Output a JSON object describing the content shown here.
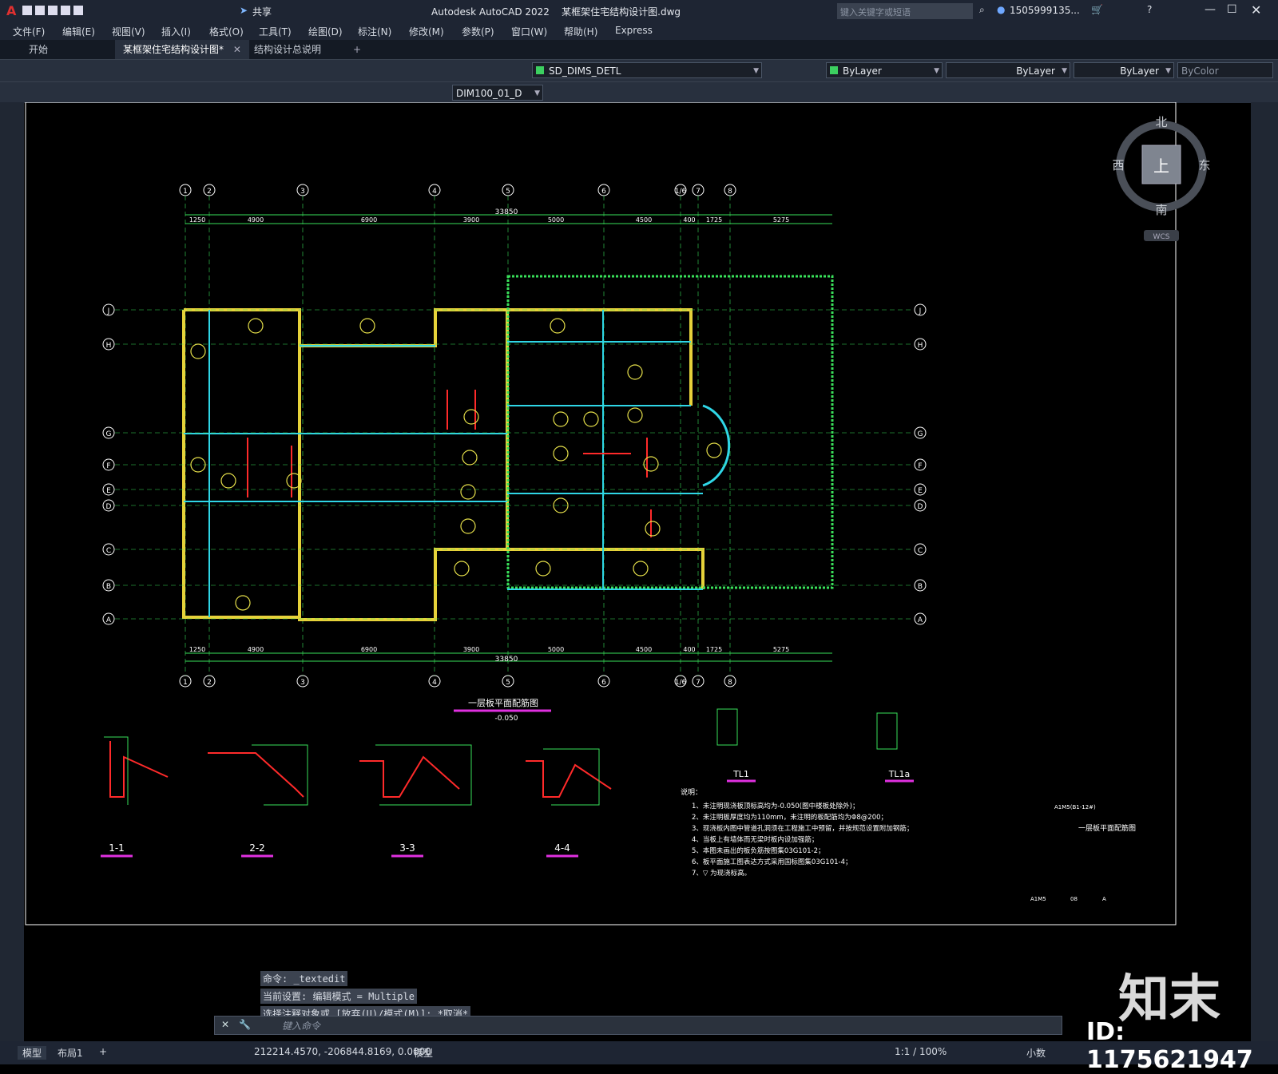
{
  "app": {
    "title": "Autodesk AutoCAD 2022    某框架住宅结构设计图.dwg",
    "share_label": "共享",
    "search_placeholder": "键入关键字或短语",
    "user": "1505999135...",
    "window_controls": [
      "minimize-icon",
      "maximize-icon",
      "close-icon"
    ]
  },
  "menu": {
    "items": [
      "文件(F)",
      "编辑(E)",
      "视图(V)",
      "插入(I)",
      "格式(O)",
      "工具(T)",
      "绘图(D)",
      "标注(N)",
      "修改(M)",
      "参数(P)",
      "窗口(W)",
      "帮助(H)",
      "Express"
    ]
  },
  "tabs": [
    {
      "label": "开始",
      "active": false
    },
    {
      "label": "某框架住宅结构设计图*",
      "active": true
    },
    {
      "label": "结构设计总说明",
      "active": false
    }
  ],
  "toolbar": {
    "layer": "SD_DIMS_DETL",
    "color": "ByLayer",
    "linetype": "ByLayer",
    "lineweight": "ByLayer",
    "plotstyle": "ByColor",
    "dimstyle": "DIM100_01_D"
  },
  "viewcube": {
    "north": "北",
    "south": "南",
    "east": "东",
    "west": "西",
    "top": "上",
    "wcs": "WCS"
  },
  "drawing": {
    "grid_top": [
      "①",
      "②",
      "③",
      "④",
      "⑤",
      "⑥",
      "1/6",
      "⑦",
      "⑧"
    ],
    "grid_side": [
      "J",
      "H",
      "G",
      "F",
      "E",
      "D",
      "C",
      "B",
      "A"
    ],
    "dims_top": [
      "1250",
      "4900",
      "6900",
      "3900",
      "5000",
      "4500",
      "400",
      "1725",
      "5275"
    ],
    "overall": "33850",
    "plan_title": "一层板平面配筋图",
    "plan_level": "-0.050",
    "sections": [
      "1-1",
      "2-2",
      "3-3",
      "4-4"
    ],
    "beams": [
      "TL1",
      "TL1a"
    ],
    "notes_title": "说明：",
    "notes": [
      "1、未注明现浇板顶标高均为-0.050(图中楼板处除外)；",
      "2、未注明板厚度均为110mm，未注明的板配筋均为Φ8@200；",
      "3、现浇板内图中管道孔洞须在工程施工中预留，并按规范设置附加钢筋；",
      "4、当板上有墙体而无梁时板内设加强筋；",
      "5、本图未画出的板负筋按图集03G101-2；",
      "6、板平面施工图表达方式采用国标图集03G101-4；",
      "7、▽ 为现浇标高。"
    ],
    "side_label": "一层板平面配筋图",
    "title_block": [
      "A1M5(B1-12#)",
      "A1M5",
      "08",
      "A"
    ]
  },
  "command": {
    "history": [
      "命令: _textedit",
      "当前设置: 编辑模式 = Multiple",
      "选择注释对象或 [放弃(U)/模式(M)]: *取消*"
    ],
    "input_placeholder": "键入命令"
  },
  "status": {
    "layout_tabs": [
      "模型",
      "布局1"
    ],
    "coords": "212214.4570, -206844.8169, 0.0000",
    "mode": "模型",
    "scale": "1:1 / 100%",
    "units": "小数"
  },
  "watermark": {
    "logo": "知末",
    "id": "ID: 1175621947"
  }
}
